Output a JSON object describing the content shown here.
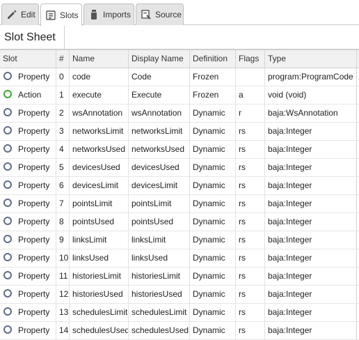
{
  "tabs": [
    {
      "label": "Edit",
      "icon": "pencil-icon",
      "active": false
    },
    {
      "label": "Slots",
      "icon": "slots-icon",
      "active": true
    },
    {
      "label": "Imports",
      "icon": "jar-icon",
      "active": false
    },
    {
      "label": "Source",
      "icon": "source-icon",
      "active": false
    }
  ],
  "header": {
    "title": "Slot Sheet"
  },
  "table": {
    "columns": [
      "Slot",
      "#",
      "Name",
      "Display Name",
      "Definition",
      "Flags",
      "Type"
    ],
    "rows": [
      {
        "slot": "Property",
        "num": "0",
        "name": "code",
        "display": "Code",
        "definition": "Frozen",
        "flags": "",
        "type": "program:ProgramCode"
      },
      {
        "slot": "Action",
        "num": "1",
        "name": "execute",
        "display": "Execute",
        "definition": "Frozen",
        "flags": "a",
        "type": "void (void)"
      },
      {
        "slot": "Property",
        "num": "2",
        "name": "wsAnnotation",
        "display": "wsAnnotation",
        "definition": "Dynamic",
        "flags": "r",
        "type": "baja:WsAnnotation"
      },
      {
        "slot": "Property",
        "num": "3",
        "name": "networksLimit",
        "display": "networksLimit",
        "definition": "Dynamic",
        "flags": "rs",
        "type": "baja:Integer"
      },
      {
        "slot": "Property",
        "num": "4",
        "name": "networksUsed",
        "display": "networksUsed",
        "definition": "Dynamic",
        "flags": "rs",
        "type": "baja:Integer"
      },
      {
        "slot": "Property",
        "num": "5",
        "name": "devicesUsed",
        "display": "devicesUsed",
        "definition": "Dynamic",
        "flags": "rs",
        "type": "baja:Integer"
      },
      {
        "slot": "Property",
        "num": "6",
        "name": "devicesLimit",
        "display": "devicesLimit",
        "definition": "Dynamic",
        "flags": "rs",
        "type": "baja:Integer"
      },
      {
        "slot": "Property",
        "num": "7",
        "name": "pointsLimit",
        "display": "pointsLimit",
        "definition": "Dynamic",
        "flags": "rs",
        "type": "baja:Integer"
      },
      {
        "slot": "Property",
        "num": "8",
        "name": "pointsUsed",
        "display": "pointsUsed",
        "definition": "Dynamic",
        "flags": "rs",
        "type": "baja:Integer"
      },
      {
        "slot": "Property",
        "num": "9",
        "name": "linksLimit",
        "display": "linksLimit",
        "definition": "Dynamic",
        "flags": "rs",
        "type": "baja:Integer"
      },
      {
        "slot": "Property",
        "num": "10",
        "name": "linksUsed",
        "display": "linksUsed",
        "definition": "Dynamic",
        "flags": "rs",
        "type": "baja:Integer"
      },
      {
        "slot": "Property",
        "num": "11",
        "name": "historiesLimit",
        "display": "historiesLimit",
        "definition": "Dynamic",
        "flags": "rs",
        "type": "baja:Integer"
      },
      {
        "slot": "Property",
        "num": "12",
        "name": "historiesUsed",
        "display": "historiesUsed",
        "definition": "Dynamic",
        "flags": "rs",
        "type": "baja:Integer"
      },
      {
        "slot": "Property",
        "num": "13",
        "name": "schedulesLimit",
        "display": "schedulesLimit",
        "definition": "Dynamic",
        "flags": "rs",
        "type": "baja:Integer"
      },
      {
        "slot": "Property",
        "num": "14",
        "name": "schedulesUsed",
        "display": "schedulesUsed",
        "definition": "Dynamic",
        "flags": "rs",
        "type": "baja:Integer"
      }
    ]
  },
  "colors": {
    "property_icon": "#5f6b86",
    "action_icon": "#3aa63a"
  }
}
